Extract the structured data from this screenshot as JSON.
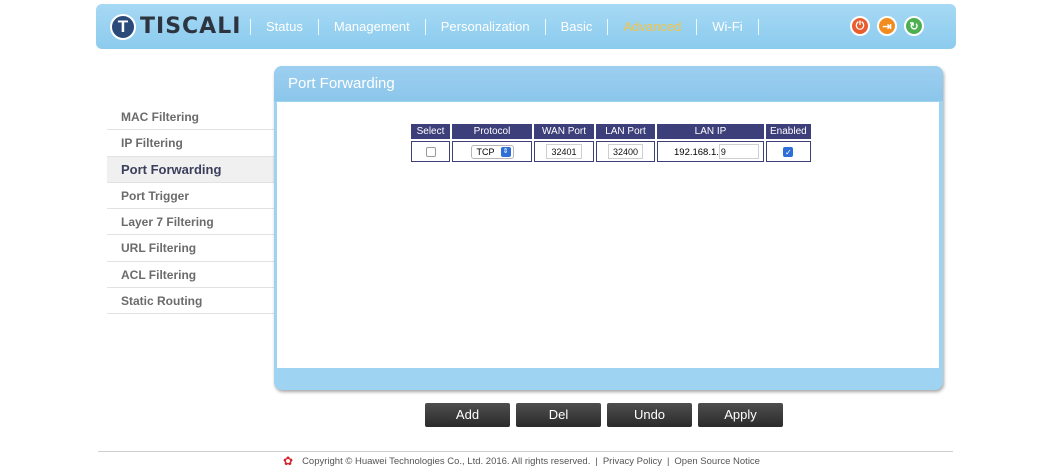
{
  "brand": {
    "logo_letter": "T",
    "name": "TISCALI"
  },
  "nav": [
    {
      "label": "Status",
      "active": false
    },
    {
      "label": "Management",
      "active": false
    },
    {
      "label": "Personalization",
      "active": false
    },
    {
      "label": "Basic",
      "active": false
    },
    {
      "label": "Advanced",
      "active": true
    },
    {
      "label": "Wi-Fi",
      "active": false
    }
  ],
  "top_icons": [
    "power-icon",
    "logout-icon",
    "refresh-icon"
  ],
  "sidebar": {
    "items": [
      {
        "label": "MAC Filtering"
      },
      {
        "label": "IP Filtering"
      },
      {
        "label": "Port Forwarding"
      },
      {
        "label": "Port Trigger"
      },
      {
        "label": "Layer 7 Filtering"
      },
      {
        "label": "URL Filtering"
      },
      {
        "label": "ACL Filtering"
      },
      {
        "label": "Static Routing"
      }
    ],
    "active_index": 2
  },
  "panel": {
    "title": "Port Forwarding",
    "table": {
      "headers": [
        "Select",
        "Protocol",
        "WAN Port",
        "LAN Port",
        "LAN IP",
        "Enabled"
      ],
      "rows": [
        {
          "select": false,
          "protocol": "TCP",
          "wan_port": "32401",
          "lan_port": "32400",
          "lan_ip_prefix": "192.168.1.",
          "lan_ip_last": "9",
          "enabled": true
        }
      ]
    }
  },
  "buttons": {
    "add": "Add",
    "del": "Del",
    "undo": "Undo",
    "apply": "Apply"
  },
  "footer": {
    "copyright": "Copyright © Huawei Technologies Co., Ltd. 2016. All rights reserved.",
    "sep": "|",
    "privacy": "Privacy Policy",
    "open_source": "Open Source Notice"
  },
  "colors": {
    "topbar": "#8ccbee",
    "active_nav": "#f5c342",
    "table_header": "#3d3f7a",
    "button": "#2b2b2b"
  }
}
